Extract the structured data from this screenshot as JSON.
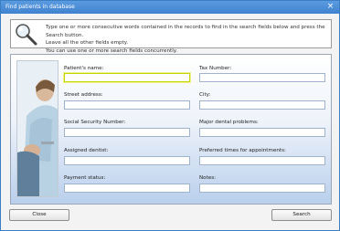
{
  "window": {
    "title": "Find patients in database",
    "close_glyph": "×"
  },
  "info": {
    "icon": "magnifier-icon",
    "lines": [
      "Type one or more consecutive words contained in the records to find in the search fields below and press the Search button.",
      "Leave all the other fields empty.",
      "You can use one or more search fields concurrently."
    ]
  },
  "form": {
    "left_fields": [
      {
        "label": "Patient's name:",
        "value": ""
      },
      {
        "label": "Street address:",
        "value": ""
      },
      {
        "label": "Social Security Number:",
        "value": ""
      },
      {
        "label": "Assigned dentist:",
        "value": ""
      },
      {
        "label": "Payment status:",
        "value": ""
      }
    ],
    "right_fields": [
      {
        "label": "Tax Number:",
        "value": ""
      },
      {
        "label": "City:",
        "value": ""
      },
      {
        "label": "Major dental problems:",
        "value": ""
      },
      {
        "label": "Preferred times for appointments:",
        "value": ""
      },
      {
        "label": "Notes:",
        "value": ""
      }
    ]
  },
  "buttons": {
    "close": "Close",
    "search": "Search"
  },
  "colors": {
    "titlebar": "#4a8ed8",
    "focus_border": "#c8d400"
  }
}
